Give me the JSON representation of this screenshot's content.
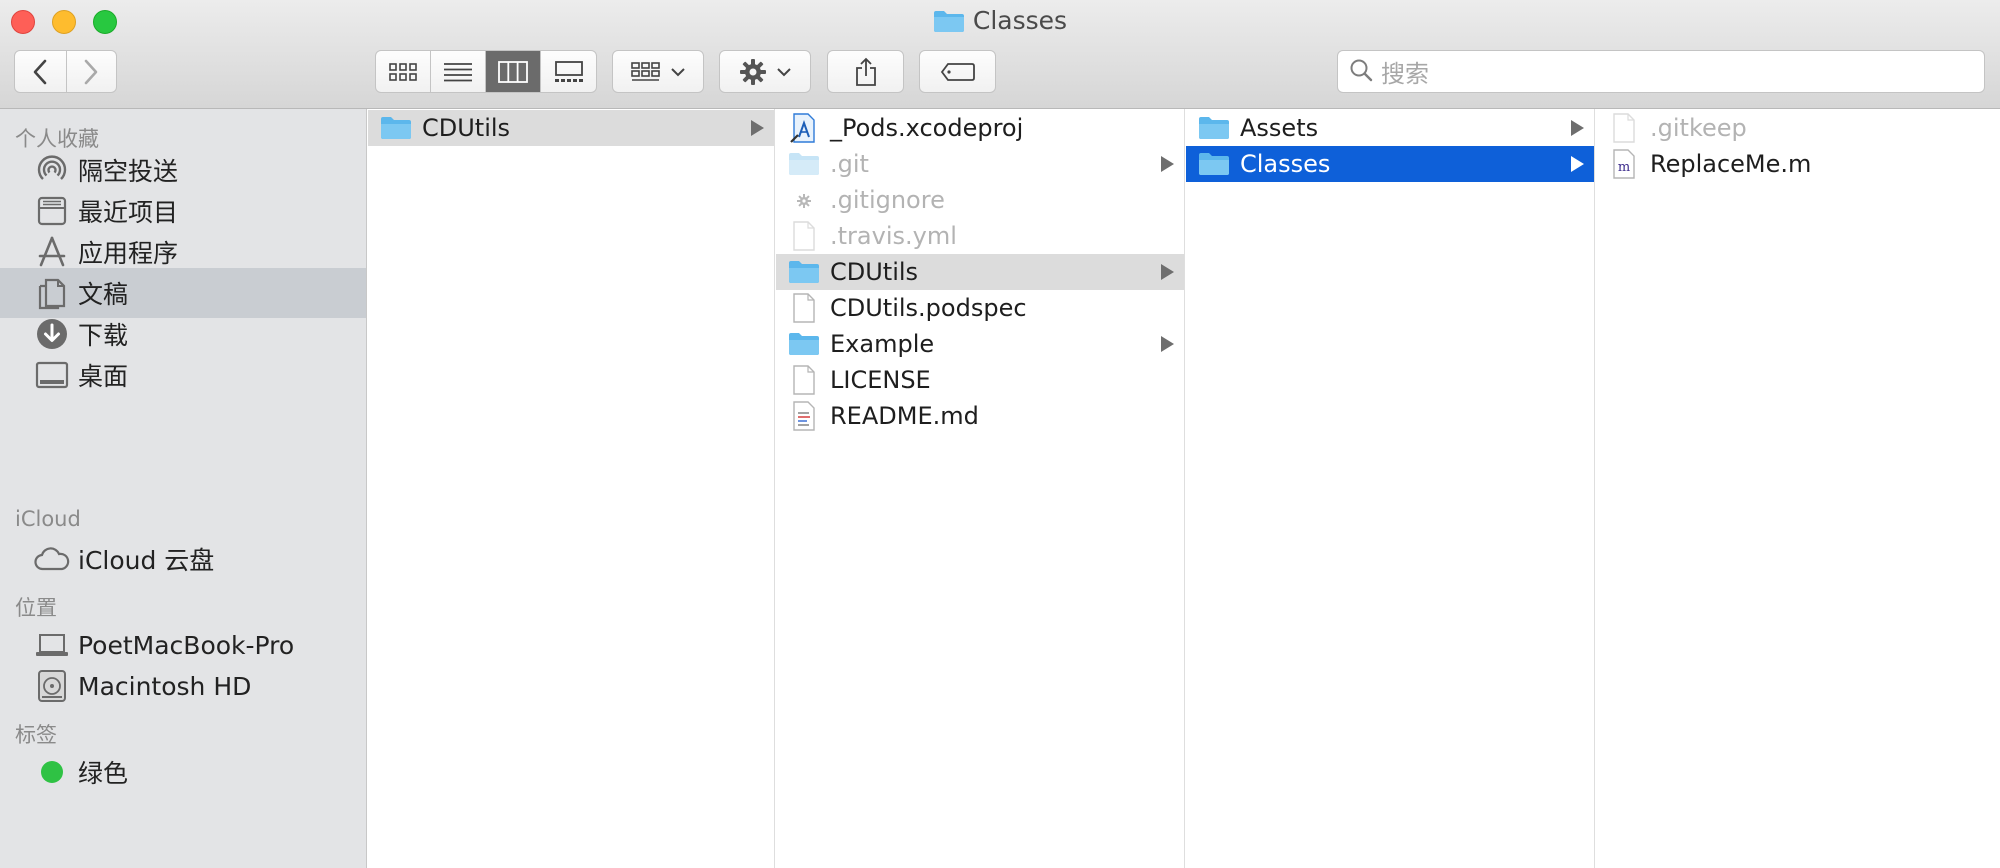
{
  "window": {
    "title": "Classes"
  },
  "toolbar": {
    "back": "chevron-left-icon",
    "forward": "chevron-right-icon",
    "views": [
      "icon-view",
      "list-view",
      "column-view",
      "gallery-view"
    ],
    "active_view": "column-view",
    "group": "group-by-icon",
    "action": "gear-icon",
    "share": "share-icon",
    "tag": "tag-icon",
    "search_placeholder": "搜索"
  },
  "sidebar": {
    "sections": [
      {
        "title": "个人收藏",
        "items": [
          {
            "label": "隔空投送",
            "icon": "airdrop-icon"
          },
          {
            "label": "最近项目",
            "icon": "recents-icon"
          },
          {
            "label": "应用程序",
            "icon": "applications-icon"
          },
          {
            "label": "文稿",
            "icon": "documents-icon",
            "selected": true
          },
          {
            "label": "下载",
            "icon": "downloads-icon"
          },
          {
            "label": "桌面",
            "icon": "desktop-icon"
          }
        ]
      },
      {
        "title": "iCloud",
        "items": [
          {
            "label": "iCloud 云盘",
            "icon": "icloud-icon"
          }
        ]
      },
      {
        "title": "位置",
        "items": [
          {
            "label": "PoetMacBook-Pro",
            "icon": "laptop-icon"
          },
          {
            "label": "Macintosh HD",
            "icon": "disk-icon"
          }
        ]
      },
      {
        "title": "标签",
        "items": [
          {
            "label": "绿色",
            "icon": "green-tag-icon",
            "color": "#2fc244"
          }
        ]
      }
    ]
  },
  "columns": [
    [
      {
        "name": "CDUtils",
        "icon": "folder",
        "folder": true,
        "state": "path"
      }
    ],
    [
      {
        "name": "_Pods.xcodeproj",
        "icon": "xcodeproj"
      },
      {
        "name": ".git",
        "icon": "folder",
        "folder": true,
        "dim": true
      },
      {
        "name": ".gitignore",
        "icon": "gear-doc",
        "dim": true
      },
      {
        "name": ".travis.yml",
        "icon": "doc",
        "dim": true
      },
      {
        "name": "CDUtils",
        "icon": "folder",
        "folder": true,
        "state": "path"
      },
      {
        "name": "CDUtils.podspec",
        "icon": "doc"
      },
      {
        "name": "Example",
        "icon": "folder",
        "folder": true
      },
      {
        "name": "LICENSE",
        "icon": "doc"
      },
      {
        "name": "README.md",
        "icon": "text-doc"
      }
    ],
    [
      {
        "name": "Assets",
        "icon": "folder",
        "folder": true
      },
      {
        "name": "Classes",
        "icon": "folder",
        "folder": true,
        "state": "active"
      }
    ],
    [
      {
        "name": ".gitkeep",
        "icon": "doc",
        "dim": true
      },
      {
        "name": "ReplaceMe.m",
        "icon": "m-doc"
      }
    ]
  ]
}
